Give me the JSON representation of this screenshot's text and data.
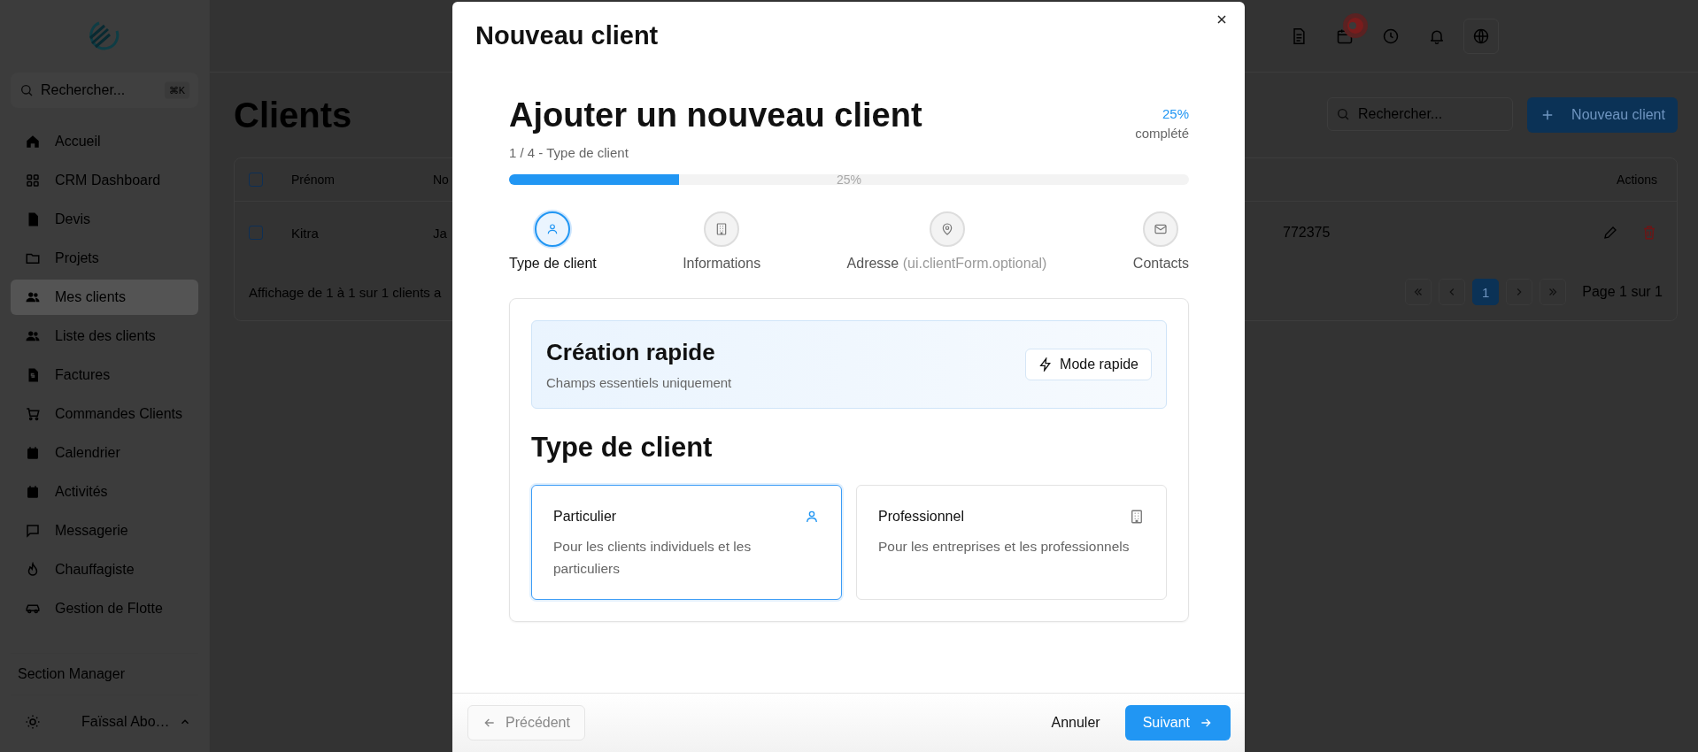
{
  "sidebar": {
    "search": {
      "placeholder": "Rechercher...",
      "shortcut": "⌘K"
    },
    "items": [
      {
        "label": "Accueil",
        "selected": false
      },
      {
        "label": "CRM Dashboard",
        "selected": false
      },
      {
        "label": "Devis",
        "selected": false
      },
      {
        "label": "Projets",
        "selected": false
      },
      {
        "label": "Mes clients",
        "selected": true
      },
      {
        "label": "Liste des clients",
        "selected": false
      },
      {
        "label": "Factures",
        "selected": false
      },
      {
        "label": "Commandes Clients",
        "selected": false
      },
      {
        "label": "Calendrier",
        "selected": false
      },
      {
        "label": "Activités",
        "selected": false
      },
      {
        "label": "Messagerie",
        "selected": false
      },
      {
        "label": "Chauffagiste",
        "selected": false
      },
      {
        "label": "Gestion de Flotte",
        "selected": false
      }
    ],
    "section": "Section Manager",
    "user": "Faïssal Abo…"
  },
  "page": {
    "title": "Clients",
    "search": {
      "placeholder": "Rechercher..."
    },
    "new_button": "Nouveau client"
  },
  "table": {
    "header_checked": false,
    "columns": [
      "Prénom",
      "No",
      "Actions"
    ],
    "rows": [
      {
        "checked": false,
        "cells": [
          "Kitra",
          "Ja",
          "772375"
        ]
      }
    ],
    "summary": "Affichage de 1 à 1 sur 1 clients a",
    "pages": [
      {
        "label": "1",
        "selected": true
      }
    ],
    "page_info": "Page 1 sur 1"
  },
  "modal": {
    "title": "Nouveau client",
    "heading": "Ajouter un nouveau client",
    "step_info": "1 / 4 - Type de client",
    "percent": "25%",
    "percent_label": "complété",
    "level": 0.25,
    "bar_label": "25%",
    "steps": [
      {
        "label": "Type de client",
        "selected": true
      },
      {
        "label": "Informations",
        "selected": false
      },
      {
        "label": "Adresse",
        "note": "(ui.clientForm.optional)",
        "selected": false
      },
      {
        "label": "Contacts",
        "selected": false
      }
    ],
    "quick": {
      "title": "Création rapide",
      "subtitle": "Champs essentiels uniquement",
      "button": "Mode rapide"
    },
    "section_title": "Type de client",
    "options": [
      {
        "title": "Particulier",
        "description": "Pour les clients individuels et les particuliers",
        "selected": true
      },
      {
        "title": "Professionnel",
        "description": "Pour les entreprises et les professionnels",
        "selected": false
      }
    ],
    "footer": {
      "previous": {
        "label": "Précédent",
        "disabled": true
      },
      "cancel": "Annuler",
      "next": "Suivant"
    }
  }
}
